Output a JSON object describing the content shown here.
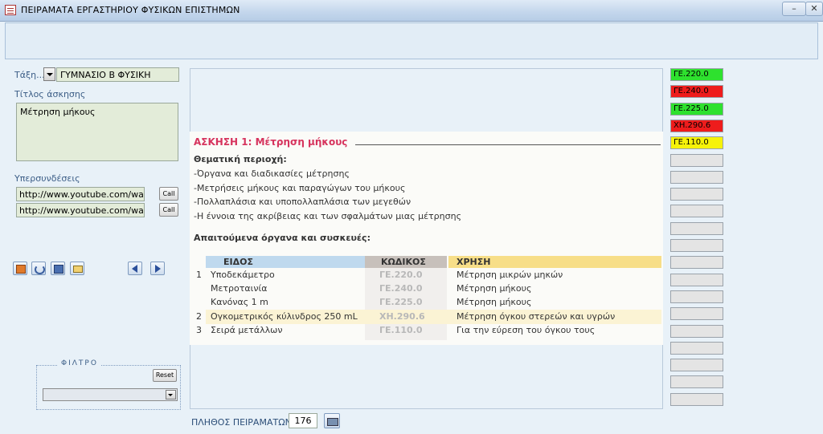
{
  "window": {
    "title": "ΠΕΙΡΑΜΑΤΑ  ΕΡΓΑΣΤΗΡΙΟΥ ΦΥΣΙΚΩΝ ΕΠΙΣΤΗΜΩΝ",
    "minimize": "–",
    "close": "✕"
  },
  "form": {
    "class_label": "Τάξη...",
    "class_value": "ΓΥΜΝΑΣΙΟ  Β  ΦΥΣΙΚΗ",
    "title_label": "Τίτλος άσκησης",
    "title_value": "Μέτρηση μήκους",
    "links_label": "Υπερσυνδέσεις",
    "links": [
      {
        "url": "http://www.youtube.com/watc",
        "button": "Call"
      },
      {
        "url": "http://www.youtube.com/watc",
        "button": "Call"
      }
    ],
    "filter_label": "ΦΙΛΤΡΟ",
    "reset_label": "Reset",
    "filter_value": "",
    "count_label": "ΠΛΗΘΟΣ ΠΕΙΡΑΜΑΤΩΝ:",
    "count_value": "176"
  },
  "document": {
    "heading": "ΑΣΚΗΣΗ 1: Μέτρηση μήκους",
    "area_label": "Θεματική περιοχή:",
    "bullets": [
      "-Όργανα και διαδικασίες μέτρησης",
      "-Μετρήσεις μήκους και παραγώγων του μήκους",
      "-Πολλαπλάσια και υποπολλαπλάσια των μεγεθών",
      "-Η έννοια της ακρίβειας και των σφαλμάτων μιας μέτρησης"
    ],
    "equipment_label": "Απαιτούμενα όργανα και συσκευές:",
    "table_headers": {
      "kind": "ΕΙΔΟΣ",
      "code": "ΚΩΔΙΚΟΣ",
      "use": "ΧΡΗΣΗ"
    },
    "rows": [
      {
        "num": "1",
        "kind": "Υποδεκάμετρο",
        "code": "ΓΕ.220.0",
        "use": "Μέτρηση μικρών μηκών"
      },
      {
        "num": "",
        "kind": "Μετροταινία",
        "code": "ΓΕ.240.0",
        "use": "Μέτρηση μήκους"
      },
      {
        "num": "",
        "kind": "Κανόνας 1 m",
        "code": "ΓΕ.225.0",
        "use": "Μέτρηση μήκους"
      },
      {
        "num": "2",
        "kind": "Ογκομετρικός κύλινδρος 250 mL",
        "code": "ΧΗ.290.6",
        "use": "Μέτρηση όγκου στερεών και υγρών"
      },
      {
        "num": "3",
        "kind": "Σειρά μετάλλων",
        "code": "ΓΕ.110.0",
        "use": "Για την εύρεση του όγκου τους"
      }
    ]
  },
  "codes": [
    {
      "label": "ΓΕ.220.0",
      "color": "#2ee12e"
    },
    {
      "label": "ΓΕ.240.0",
      "color": "#ee1c1c"
    },
    {
      "label": "ΓΕ.225.0",
      "color": "#2ee12e"
    },
    {
      "label": "ΧΗ.290.6",
      "color": "#ee1c1c"
    },
    {
      "label": "ΓΕ.110.0",
      "color": "#f6f20a"
    },
    {
      "label": "",
      "color": "#e4e4e4"
    },
    {
      "label": "",
      "color": "#e4e4e4"
    },
    {
      "label": "",
      "color": "#e4e4e4"
    },
    {
      "label": "",
      "color": "#e4e4e4"
    },
    {
      "label": "",
      "color": "#e4e4e4"
    },
    {
      "label": "",
      "color": "#e4e4e4"
    },
    {
      "label": "",
      "color": "#e4e4e4"
    },
    {
      "label": "",
      "color": "#e4e4e4"
    },
    {
      "label": "",
      "color": "#e4e4e4"
    },
    {
      "label": "",
      "color": "#e4e4e4"
    },
    {
      "label": "",
      "color": "#e4e4e4"
    },
    {
      "label": "",
      "color": "#e4e4e4"
    },
    {
      "label": "",
      "color": "#e4e4e4"
    },
    {
      "label": "",
      "color": "#e4e4e4"
    },
    {
      "label": "",
      "color": "#e4e4e4"
    }
  ]
}
